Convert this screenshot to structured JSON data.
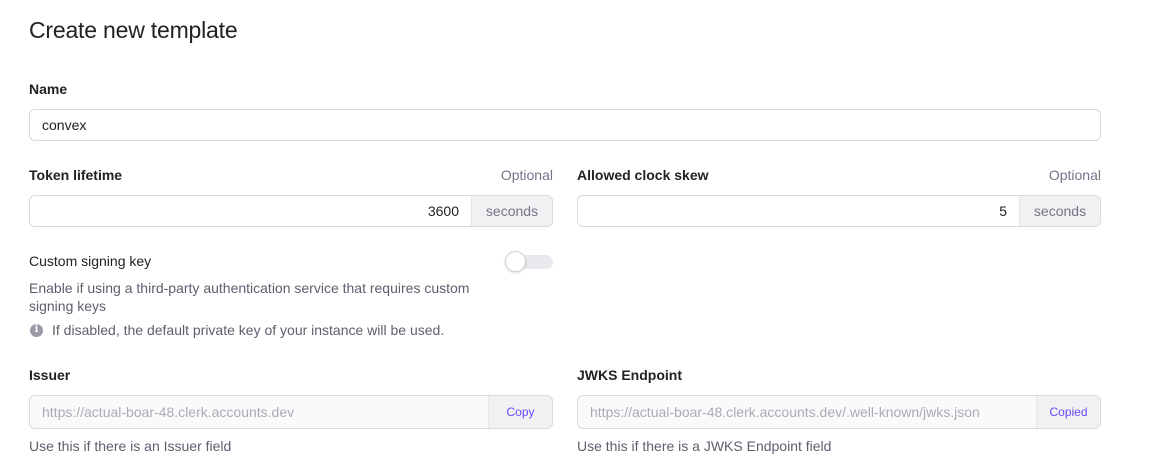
{
  "page": {
    "title": "Create new template"
  },
  "name_field": {
    "label": "Name",
    "value": "convex"
  },
  "token_lifetime": {
    "label": "Token lifetime",
    "optional": "Optional",
    "value": "3600",
    "unit": "seconds"
  },
  "clock_skew": {
    "label": "Allowed clock skew",
    "optional": "Optional",
    "value": "5",
    "unit": "seconds"
  },
  "custom_signing_key": {
    "label": "Custom signing key",
    "enabled": false,
    "description": "Enable if using a third-party authentication service that requires custom signing keys",
    "info": "If disabled, the default private key of your instance will be used."
  },
  "issuer": {
    "label": "Issuer",
    "value": "https://actual-boar-48.clerk.accounts.dev",
    "button": "Copy",
    "help": "Use this if there is an Issuer field"
  },
  "jwks": {
    "label": "JWKS Endpoint",
    "value": "https://actual-boar-48.clerk.accounts.dev/.well-known/jwks.json",
    "button": "Copied",
    "help": "Use this if there is a JWKS Endpoint field"
  },
  "colors": {
    "accent": "#6c47ff",
    "text": "#212126",
    "muted": "#747686",
    "border": "#d9d9de"
  },
  "icons": {
    "info": "info-circle-icon"
  }
}
